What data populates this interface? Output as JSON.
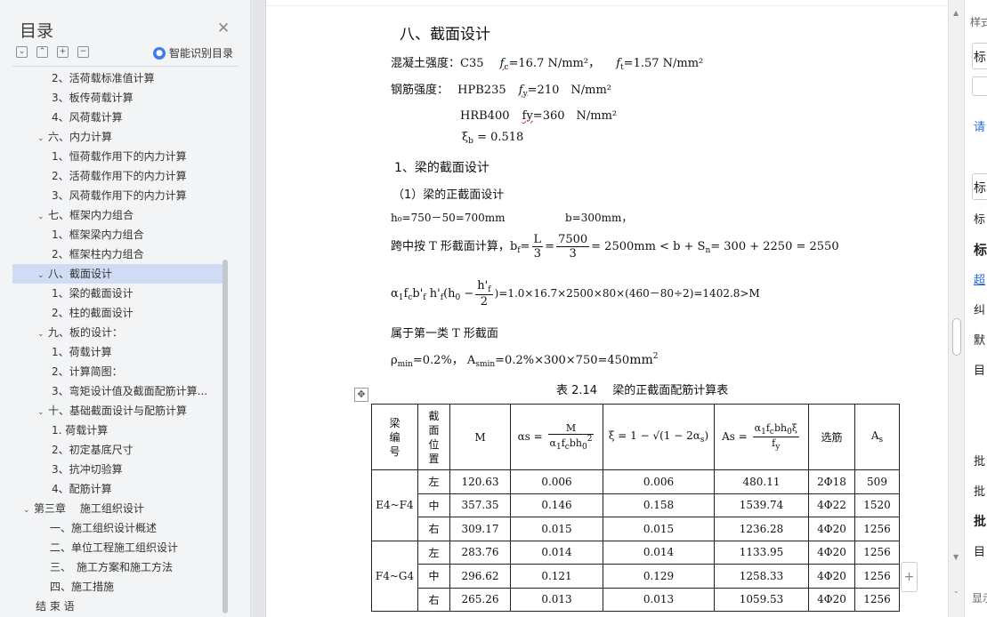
{
  "toc": {
    "title": "目录",
    "smart_label": "智能识别目录",
    "items": [
      {
        "label": "2、活荷载标准值计算",
        "level": 2
      },
      {
        "label": "3、板传荷载计算",
        "level": 2
      },
      {
        "label": "4、风荷载计算",
        "level": 2
      },
      {
        "label": "六、内力计算",
        "level": 1
      },
      {
        "label": "1、恒荷载作用下的内力计算",
        "level": 2
      },
      {
        "label": "2、活荷载作用下的内力计算",
        "level": 2
      },
      {
        "label": "3、风荷载作用下的内力计算",
        "level": 2
      },
      {
        "label": "七、框架内力组合",
        "level": 1
      },
      {
        "label": "1、框架梁内力组合",
        "level": 2
      },
      {
        "label": "2、框架柱内力组合",
        "level": 2
      },
      {
        "label": "八、截面设计",
        "level": 1,
        "selected": true
      },
      {
        "label": "1、梁的截面设计",
        "level": 2
      },
      {
        "label": "2、柱的截面设计",
        "level": 2
      },
      {
        "label": "九、板的设计：",
        "level": 1
      },
      {
        "label": "1、荷载计算",
        "level": 2
      },
      {
        "label": "2、计算简图：",
        "level": 2
      },
      {
        "label": "3、弯矩设计值及截面配筋计算...",
        "level": 2
      },
      {
        "label": "十、基础截面设计与配筋计算",
        "level": 1
      },
      {
        "label": "1. 荷载计算",
        "level": 2
      },
      {
        "label": "2、初定基底尺寸",
        "level": 2
      },
      {
        "label": "3、抗冲切验算",
        "level": 2
      },
      {
        "label": "4、配筋计算",
        "level": 2
      },
      {
        "label": "第三章　 施工组织设计",
        "level": 0
      },
      {
        "label": "一、施工组织设计概述",
        "level": 3
      },
      {
        "label": "二、单位工程施工组织设计",
        "level": 3
      },
      {
        "label": "三、　施工方案和施工方法",
        "level": 3
      },
      {
        "label": "四、施工措施",
        "level": 3
      },
      {
        "label": "结 束 语",
        "level": 4
      }
    ]
  },
  "doc": {
    "heading": "八、截面设计",
    "concrete_label": "混凝土强度：C35",
    "fc": "=16.7 N/mm²，",
    "ft": "=1.57 N/mm²",
    "steel_label": "钢筋强度：",
    "hpb": "HPB235",
    "hpb_val": "=210　N/mm²",
    "hrb": "HRB400",
    "hrb_val": "=360　N/mm²",
    "xi_b": "= 0.518",
    "sec1": "1、梁的截面设计",
    "sec1_1": "（1）梁的正截面设计",
    "h0_line": "h₀=750－50=700mm",
    "b_line": "b=300mm，",
    "t_prefix": "跨中按 T 形截面计算，",
    "t_mid": "= 2500mm < b + S",
    "t_tail": "= 300 + 2250 = 2550",
    "m_tail": ")=1.0×16.7×2500×80×(460－80÷2)=1402.8>M",
    "first_class": "属于第一类 T 形截面",
    "rho": "=0.2%，",
    "as_min": "=0.2%×300×750=450",
    "as_unit": "mm"
  },
  "table": {
    "caption": "表 2.14　 梁的正截面配筋计算表",
    "headers": [
      "梁编号",
      "截面位置",
      "M",
      "αs",
      "ξ",
      "As",
      "选筋",
      "As"
    ],
    "groups": [
      {
        "beam": "E4~F4",
        "rows": [
          [
            "左",
            "120.63",
            "0.006",
            "0.006",
            "480.11",
            "2Φ18",
            "509"
          ],
          [
            "中",
            "357.35",
            "0.146",
            "0.158",
            "1539.74",
            "4Φ22",
            "1520"
          ],
          [
            "右",
            "309.17",
            "0.015",
            "0.015",
            "1236.28",
            "4Φ20",
            "1256"
          ]
        ]
      },
      {
        "beam": "F4~G4",
        "rows": [
          [
            "左",
            "283.76",
            "0.014",
            "0.014",
            "1133.95",
            "4Φ20",
            "1256"
          ],
          [
            "中",
            "296.62",
            "0.121",
            "0.129",
            "1258.33",
            "4Φ20",
            "1256"
          ],
          [
            "右",
            "265.26",
            "0.013",
            "0.013",
            "1059.53",
            "4Φ20",
            "1256"
          ]
        ]
      }
    ]
  },
  "right_pane": {
    "top_label": "样式",
    "items": [
      "标",
      "请",
      "标",
      "标",
      "标",
      "超",
      "纠",
      "默",
      "目",
      "批",
      "批",
      "批",
      "目",
      "显示"
    ]
  }
}
